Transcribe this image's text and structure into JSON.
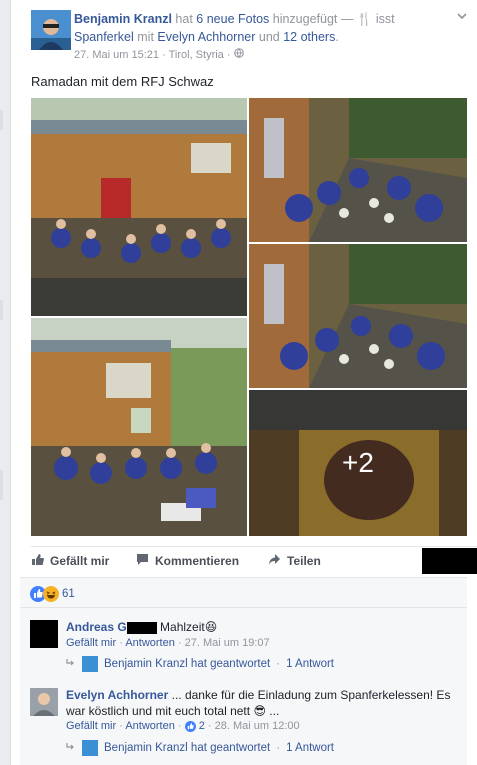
{
  "post": {
    "author": "Benjamin Kranzl",
    "verb_has": "hat",
    "photo_count": "6 neue Fotos",
    "verb_added": "hinzugefügt —",
    "activity": "isst",
    "activity_target": "Spanferkel",
    "with": "mit",
    "tagged": "Evelyn Achhorner",
    "and": "und",
    "others": "12 others",
    "period": ".",
    "timestamp": "27. Mai um 15:21",
    "location": "Tirol, Styria",
    "sep": "·",
    "text": "Ramadan mit dem RFJ Schwaz",
    "more_photos": "+2"
  },
  "actions": {
    "like": "Gefällt mir",
    "comment": "Kommentieren",
    "share": "Teilen"
  },
  "reactions": {
    "count": "61"
  },
  "comments": [
    {
      "name": "Andreas G",
      "text": "Mahlzeit",
      "emoji": "😆",
      "like": "Gefällt mir",
      "reply": "Antworten",
      "time": "27. Mai um 19:07",
      "replies": {
        "label": "Benjamin Kranzl hat geantwortet",
        "count": "1 Antwort"
      }
    },
    {
      "name": "Evelyn Achhorner",
      "text": "... danke für die Einladung zum Spanferkelessen! Es war köstlich und mit euch total nett",
      "emoji": "😎",
      "ellipsis": "...",
      "like": "Gefällt mir",
      "reply": "Antworten",
      "likes": "2",
      "time": "28. Mai um 12:00",
      "replies": {
        "label": "Benjamin Kranzl hat geantwortet",
        "count": "1 Antwort"
      }
    }
  ],
  "dots": "·",
  "icons": [
    "fork-knife-icon",
    "globe-icon",
    "chevron-down-icon",
    "like-icon",
    "comment-icon",
    "share-icon",
    "reply-arrow-icon",
    "haha-reaction-icon"
  ]
}
